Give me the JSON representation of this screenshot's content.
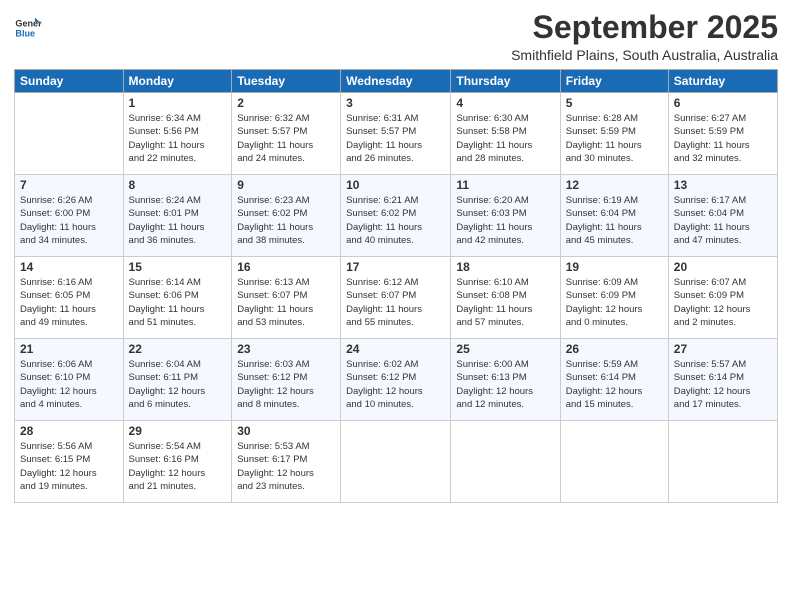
{
  "logo": {
    "text_general": "General",
    "text_blue": "Blue"
  },
  "header": {
    "month": "September 2025",
    "location": "Smithfield Plains, South Australia, Australia"
  },
  "days_of_week": [
    "Sunday",
    "Monday",
    "Tuesday",
    "Wednesday",
    "Thursday",
    "Friday",
    "Saturday"
  ],
  "weeks": [
    [
      {
        "day": "",
        "info": ""
      },
      {
        "day": "1",
        "info": "Sunrise: 6:34 AM\nSunset: 5:56 PM\nDaylight: 11 hours\nand 22 minutes."
      },
      {
        "day": "2",
        "info": "Sunrise: 6:32 AM\nSunset: 5:57 PM\nDaylight: 11 hours\nand 24 minutes."
      },
      {
        "day": "3",
        "info": "Sunrise: 6:31 AM\nSunset: 5:57 PM\nDaylight: 11 hours\nand 26 minutes."
      },
      {
        "day": "4",
        "info": "Sunrise: 6:30 AM\nSunset: 5:58 PM\nDaylight: 11 hours\nand 28 minutes."
      },
      {
        "day": "5",
        "info": "Sunrise: 6:28 AM\nSunset: 5:59 PM\nDaylight: 11 hours\nand 30 minutes."
      },
      {
        "day": "6",
        "info": "Sunrise: 6:27 AM\nSunset: 5:59 PM\nDaylight: 11 hours\nand 32 minutes."
      }
    ],
    [
      {
        "day": "7",
        "info": "Sunrise: 6:26 AM\nSunset: 6:00 PM\nDaylight: 11 hours\nand 34 minutes."
      },
      {
        "day": "8",
        "info": "Sunrise: 6:24 AM\nSunset: 6:01 PM\nDaylight: 11 hours\nand 36 minutes."
      },
      {
        "day": "9",
        "info": "Sunrise: 6:23 AM\nSunset: 6:02 PM\nDaylight: 11 hours\nand 38 minutes."
      },
      {
        "day": "10",
        "info": "Sunrise: 6:21 AM\nSunset: 6:02 PM\nDaylight: 11 hours\nand 40 minutes."
      },
      {
        "day": "11",
        "info": "Sunrise: 6:20 AM\nSunset: 6:03 PM\nDaylight: 11 hours\nand 42 minutes."
      },
      {
        "day": "12",
        "info": "Sunrise: 6:19 AM\nSunset: 6:04 PM\nDaylight: 11 hours\nand 45 minutes."
      },
      {
        "day": "13",
        "info": "Sunrise: 6:17 AM\nSunset: 6:04 PM\nDaylight: 11 hours\nand 47 minutes."
      }
    ],
    [
      {
        "day": "14",
        "info": "Sunrise: 6:16 AM\nSunset: 6:05 PM\nDaylight: 11 hours\nand 49 minutes."
      },
      {
        "day": "15",
        "info": "Sunrise: 6:14 AM\nSunset: 6:06 PM\nDaylight: 11 hours\nand 51 minutes."
      },
      {
        "day": "16",
        "info": "Sunrise: 6:13 AM\nSunset: 6:07 PM\nDaylight: 11 hours\nand 53 minutes."
      },
      {
        "day": "17",
        "info": "Sunrise: 6:12 AM\nSunset: 6:07 PM\nDaylight: 11 hours\nand 55 minutes."
      },
      {
        "day": "18",
        "info": "Sunrise: 6:10 AM\nSunset: 6:08 PM\nDaylight: 11 hours\nand 57 minutes."
      },
      {
        "day": "19",
        "info": "Sunrise: 6:09 AM\nSunset: 6:09 PM\nDaylight: 12 hours\nand 0 minutes."
      },
      {
        "day": "20",
        "info": "Sunrise: 6:07 AM\nSunset: 6:09 PM\nDaylight: 12 hours\nand 2 minutes."
      }
    ],
    [
      {
        "day": "21",
        "info": "Sunrise: 6:06 AM\nSunset: 6:10 PM\nDaylight: 12 hours\nand 4 minutes."
      },
      {
        "day": "22",
        "info": "Sunrise: 6:04 AM\nSunset: 6:11 PM\nDaylight: 12 hours\nand 6 minutes."
      },
      {
        "day": "23",
        "info": "Sunrise: 6:03 AM\nSunset: 6:12 PM\nDaylight: 12 hours\nand 8 minutes."
      },
      {
        "day": "24",
        "info": "Sunrise: 6:02 AM\nSunset: 6:12 PM\nDaylight: 12 hours\nand 10 minutes."
      },
      {
        "day": "25",
        "info": "Sunrise: 6:00 AM\nSunset: 6:13 PM\nDaylight: 12 hours\nand 12 minutes."
      },
      {
        "day": "26",
        "info": "Sunrise: 5:59 AM\nSunset: 6:14 PM\nDaylight: 12 hours\nand 15 minutes."
      },
      {
        "day": "27",
        "info": "Sunrise: 5:57 AM\nSunset: 6:14 PM\nDaylight: 12 hours\nand 17 minutes."
      }
    ],
    [
      {
        "day": "28",
        "info": "Sunrise: 5:56 AM\nSunset: 6:15 PM\nDaylight: 12 hours\nand 19 minutes."
      },
      {
        "day": "29",
        "info": "Sunrise: 5:54 AM\nSunset: 6:16 PM\nDaylight: 12 hours\nand 21 minutes."
      },
      {
        "day": "30",
        "info": "Sunrise: 5:53 AM\nSunset: 6:17 PM\nDaylight: 12 hours\nand 23 minutes."
      },
      {
        "day": "",
        "info": ""
      },
      {
        "day": "",
        "info": ""
      },
      {
        "day": "",
        "info": ""
      },
      {
        "day": "",
        "info": ""
      }
    ]
  ]
}
